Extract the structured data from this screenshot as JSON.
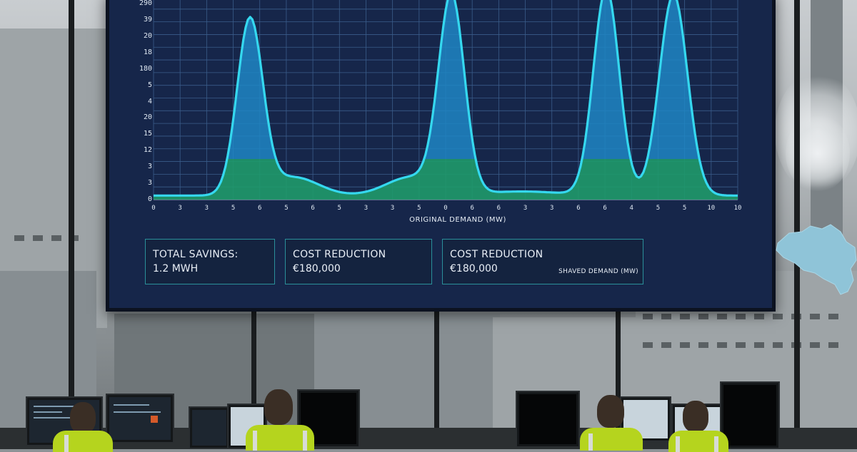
{
  "chart_data": {
    "type": "area",
    "title": "",
    "xlabel": "ORIGINAL DEMAND (MW)",
    "ylabel": "",
    "y_tick_labels": [
      "290",
      "39",
      "20",
      "18",
      "180",
      "5",
      "4",
      "20",
      "15",
      "12",
      "3",
      "3",
      "0"
    ],
    "x_tick_labels": [
      "0",
      "3",
      "3",
      "5",
      "6",
      "5",
      "6",
      "5",
      "3",
      "3",
      "5",
      "0",
      "6",
      "6",
      "3",
      "3",
      "6",
      "6",
      "4",
      "5",
      "5",
      "10",
      "10"
    ],
    "grid": true,
    "peak_positions": [
      0.165,
      0.51,
      0.775,
      0.89
    ],
    "series": [
      {
        "values": [
          0.02,
          0.05,
          0.2,
          0.85,
          0.2,
          0.12,
          0.1,
          0.2,
          0.95,
          0.2,
          0.12,
          0.1,
          0.25,
          1.0,
          0.25,
          0.05,
          0.03,
          0.02,
          0.02,
          0.02,
          0.03,
          0.2,
          0.96,
          0.2,
          0.04,
          0.02,
          0.02
        ]
      }
    ],
    "threshold_fraction": 0.2,
    "colors": {
      "line": "#35d8ef",
      "above_fill": "#1f86c4",
      "below_fill": "#1f9a6a",
      "grid": "#3a5c8a",
      "background": "#16264a"
    }
  },
  "cards": [
    {
      "title": "TOTAL SAVINGS:",
      "value": "1.2 MWH"
    },
    {
      "title": "COST REDUCTION",
      "value": "€180,000"
    },
    {
      "title": "COST REDUCTION",
      "value": "€180,000",
      "note": "SHAVED DEMAND (MW)"
    }
  ],
  "map": {
    "icon": "belgium-map-icon",
    "color": "#8fc4d8"
  }
}
